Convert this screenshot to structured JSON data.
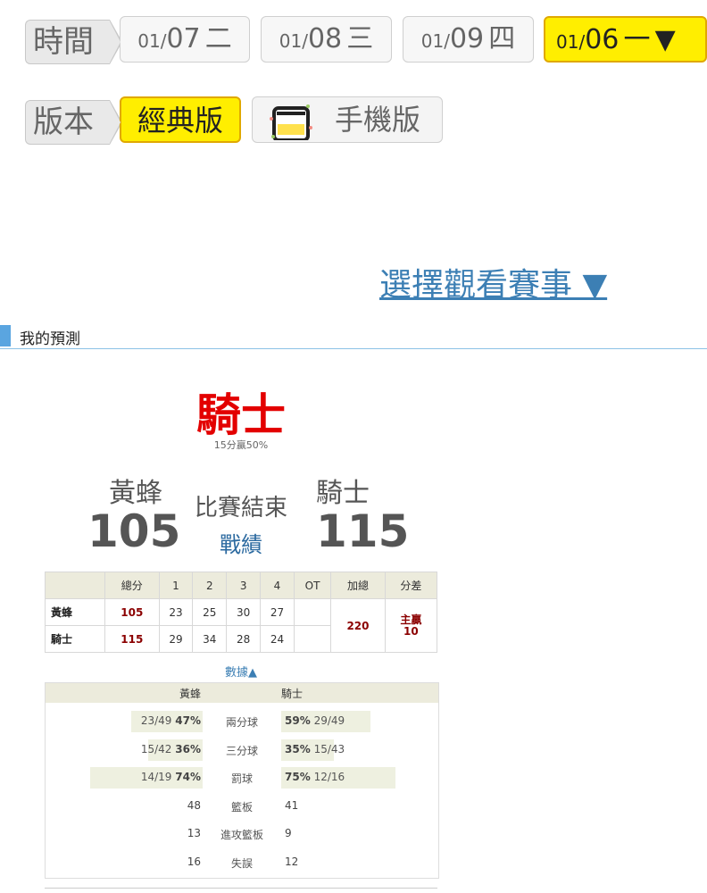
{
  "time_row": {
    "label": "時間",
    "dates": [
      {
        "md": "01/",
        "day": "07",
        "weekday": "二"
      },
      {
        "md": "01/",
        "day": "08",
        "weekday": "三"
      },
      {
        "md": "01/",
        "day": "09",
        "weekday": "四"
      }
    ],
    "active": {
      "md": "01/",
      "day": "06",
      "weekday": "一",
      "arrow": "▼"
    }
  },
  "version_row": {
    "label": "版本",
    "classic": "經典版",
    "mobile": "手機版"
  },
  "select_game": "選擇觀看賽事 ▼",
  "section_title": "我的預測",
  "prediction": {
    "team": "騎士",
    "sub": "15分贏50%"
  },
  "game": {
    "away_name": "黃蜂",
    "home_name": "騎士",
    "away_score": "105",
    "home_score": "115",
    "status": "比賽結束",
    "record_link": "戰績"
  },
  "score_table": {
    "headers": [
      "",
      "總分",
      "1",
      "2",
      "3",
      "4",
      "OT",
      "加總",
      "分差"
    ],
    "rows": [
      {
        "team": "黃蜂",
        "total": "105",
        "q": [
          "23",
          "25",
          "30",
          "27"
        ],
        "ot": ""
      },
      {
        "team": "騎士",
        "total": "115",
        "q": [
          "29",
          "34",
          "28",
          "24"
        ],
        "ot": ""
      }
    ],
    "sum": "220",
    "diff_line1": "主贏",
    "diff_line2": "10"
  },
  "data_toggle": "數據▲",
  "stats": {
    "away": "黃蜂",
    "home": "騎士",
    "rows": [
      {
        "label": "兩分球",
        "away_frac": "23/49",
        "away_pct": "47%",
        "home_pct": "59%",
        "home_frac": "29/49",
        "away_ratio": 0.47,
        "home_ratio": 0.59
      },
      {
        "label": "三分球",
        "away_frac": "15/42",
        "away_pct": "36%",
        "home_pct": "35%",
        "home_frac": "15/43",
        "away_ratio": 0.36,
        "home_ratio": 0.35
      },
      {
        "label": "罰球",
        "away_frac": "14/19",
        "away_pct": "74%",
        "home_pct": "75%",
        "home_frac": "12/16",
        "away_ratio": 0.74,
        "home_ratio": 0.75
      },
      {
        "label": "籃板",
        "away_frac": "",
        "away_pct": "48",
        "home_pct": "41",
        "home_frac": ""
      },
      {
        "label": "進攻籃板",
        "away_frac": "",
        "away_pct": "13",
        "home_pct": "9",
        "home_frac": ""
      },
      {
        "label": "失誤",
        "away_frac": "",
        "away_pct": "16",
        "home_pct": "12",
        "home_frac": ""
      }
    ]
  },
  "colors": {
    "active_yellow": "#ffee00",
    "prediction_red": "#e30000",
    "link_blue": "#3c7fb4",
    "section_accent": "#5aa5e0"
  }
}
